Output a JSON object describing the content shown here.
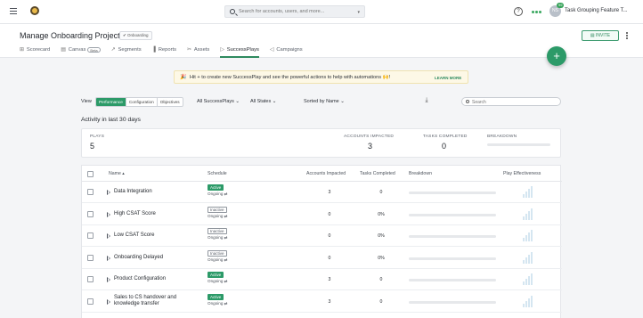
{
  "topbar": {
    "search_placeholder": "Search for accounts, users, and more...",
    "notification_count": "99",
    "avatar_initials": "NS",
    "workspace_name": "Task Grouping Feature T..."
  },
  "header": {
    "title": "Manage Onboarding Projects",
    "tag": "✔ Onboarding",
    "invite_label": "INVITE",
    "tabs": [
      {
        "label": "Scorecard",
        "icon": "scorecard-icon",
        "glyph": "⊞"
      },
      {
        "label": "Canvas",
        "icon": "canvas-icon",
        "glyph": "▤",
        "badge": "Beta"
      },
      {
        "label": "Segments",
        "icon": "segments-icon",
        "glyph": "↗"
      },
      {
        "label": "Reports",
        "icon": "reports-icon",
        "glyph": "▐"
      },
      {
        "label": "Assets",
        "icon": "assets-icon",
        "glyph": "✂"
      },
      {
        "label": "SuccessPlays",
        "icon": "play-icon",
        "glyph": "▷"
      },
      {
        "label": "Campaigns",
        "icon": "megaphone-icon",
        "glyph": "◁"
      }
    ],
    "active_tab": "SuccessPlays"
  },
  "fab": {
    "label": "+"
  },
  "banner": {
    "icon": "🎉",
    "text": "Hit + to create new SuccessPlay and see the powerful actions to help with automations 🙌!",
    "link_label": "LEARN MORE"
  },
  "filters": {
    "view_label": "View",
    "views": [
      "Performance",
      "Configuration",
      "Objectives"
    ],
    "active_view": "Performance",
    "plays_filter": "All SuccessPlays ⌄",
    "states_filter": "All States ⌄",
    "sort_label": "Sorted by Name ⌄",
    "search_placeholder": "Search"
  },
  "activity": {
    "title": "Activity in last 30 days",
    "plays_label": "PLAYS",
    "plays_value": "5",
    "accounts_label": "ACCOUNTS IMPACTED",
    "accounts_value": "3",
    "tasks_label": "TASKS COMPLETED",
    "tasks_value": "0",
    "breakdown_label": "BREAKDOWN"
  },
  "table": {
    "columns": {
      "name": "Name ▴",
      "schedule": "Schedule",
      "accounts": "Accounts Impacted",
      "tasks": "Tasks Completed",
      "breakdown": "Breakdown",
      "effectiveness": "Play Effectiveness"
    },
    "rows": [
      {
        "name": "Data Integration",
        "status": "Active",
        "schedule": "Ongoing ⇄",
        "accounts": "3",
        "tasks": "0"
      },
      {
        "name": "High CSAT Score",
        "status": "Inactive",
        "schedule": "Ongoing ⇄",
        "accounts": "0",
        "tasks": "0%"
      },
      {
        "name": "Low CSAT Score",
        "status": "Inactive",
        "schedule": "Ongoing ⇄",
        "accounts": "0",
        "tasks": "0%"
      },
      {
        "name": "Onboarding Delayed",
        "status": "Inactive",
        "schedule": "Ongoing ⇄",
        "accounts": "0",
        "tasks": "0%"
      },
      {
        "name": "Product Configuration",
        "status": "Active",
        "schedule": "Ongoing ⇄",
        "accounts": "3",
        "tasks": "0"
      },
      {
        "name": "Sales to CS handover and knowledge transfer",
        "status": "Active",
        "schedule": "Ongoing ⇄",
        "accounts": "3",
        "tasks": "0"
      }
    ]
  },
  "colors": {
    "accent": "#2c9a68",
    "banner_bg": "#fdf8e6",
    "page_bg": "#f4f5f7"
  }
}
